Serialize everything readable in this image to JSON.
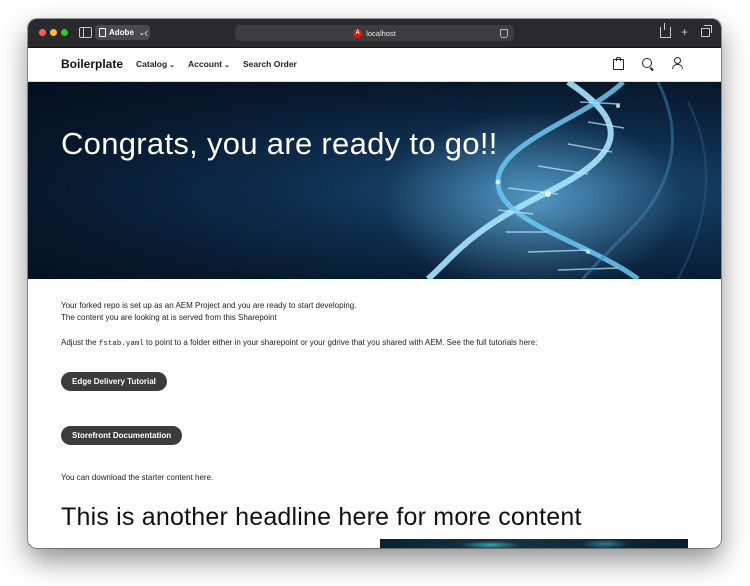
{
  "browser": {
    "tab_group_label": "Adobe",
    "url": "localhost",
    "favicon_glyph": "A",
    "colors": {
      "close": "#ff5f57",
      "minimize": "#febc2e",
      "zoom": "#28c840",
      "favicon": "#eb1000"
    }
  },
  "header": {
    "brand": "Boilerplate",
    "nav": [
      {
        "label": "Catalog",
        "has_dropdown": true
      },
      {
        "label": "Account",
        "has_dropdown": true
      },
      {
        "label": "Search Order",
        "has_dropdown": false
      }
    ],
    "icons": [
      "cart-icon",
      "search-icon",
      "user-icon"
    ]
  },
  "hero": {
    "title": "Congrats, you are ready to go!!"
  },
  "main": {
    "intro_line1": "Your forked repo is set up as an AEM Project and you are ready to start developing.",
    "intro_line2_prefix": "The content you are looking at is served from this ",
    "intro_line2_link": "Sharepoint",
    "adjust_prefix": "Adjust the ",
    "adjust_code": "fstab.yaml",
    "adjust_suffix": " to point to a folder either in your sharepoint or your gdrive that you shared with AEM. See the full tutorials here:",
    "button_tutorial": "Edge Delivery Tutorial",
    "button_docs": "Storefront Documentation",
    "download_prefix": "You can download the starter content ",
    "download_link": "here",
    "download_suffix": ".",
    "headline": "This is another headline here for more content"
  }
}
